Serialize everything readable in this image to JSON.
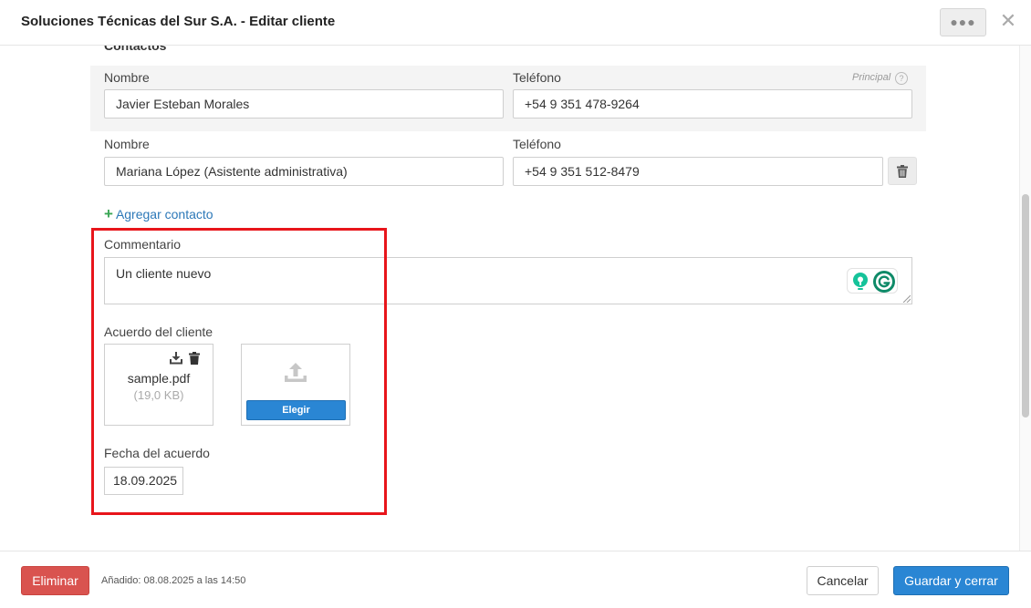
{
  "header": {
    "title": "Soluciones Técnicas del Sur S.A. - Editar cliente",
    "more_label": "●●●",
    "close_label": "✕"
  },
  "contacts": {
    "section_title": "Contactos",
    "principal_label": "Principal",
    "help_label": "?",
    "add_label": "Agregar contacto",
    "items": [
      {
        "name_label": "Nombre",
        "name": "Javier Esteban Morales",
        "phone_label": "Teléfono",
        "phone": "+54 9 351 478-9264"
      },
      {
        "name_label": "Nombre",
        "name": "Mariana López (Asistente administrativa)",
        "phone_label": "Teléfono",
        "phone": "+54 9 351 512-8479"
      }
    ]
  },
  "comment": {
    "label": "Commentario",
    "value": "Un cliente nuevo"
  },
  "agreement": {
    "label": "Acuerdo del cliente",
    "file_name": "sample.pdf",
    "file_size": "(19,0 KB)",
    "choose_label": "Elegir"
  },
  "agreement_date": {
    "label": "Fecha del acuerdo",
    "value": "18.09.2025"
  },
  "footer": {
    "delete_label": "Eliminar",
    "added_text": "Añadido: 08.08.2025 a las 14:50",
    "cancel_label": "Cancelar",
    "save_label": "Guardar y cerrar"
  },
  "colors": {
    "primary": "#2a86d4",
    "danger": "#d9534f",
    "highlight": "#e8151b",
    "link": "#2c78b8"
  }
}
